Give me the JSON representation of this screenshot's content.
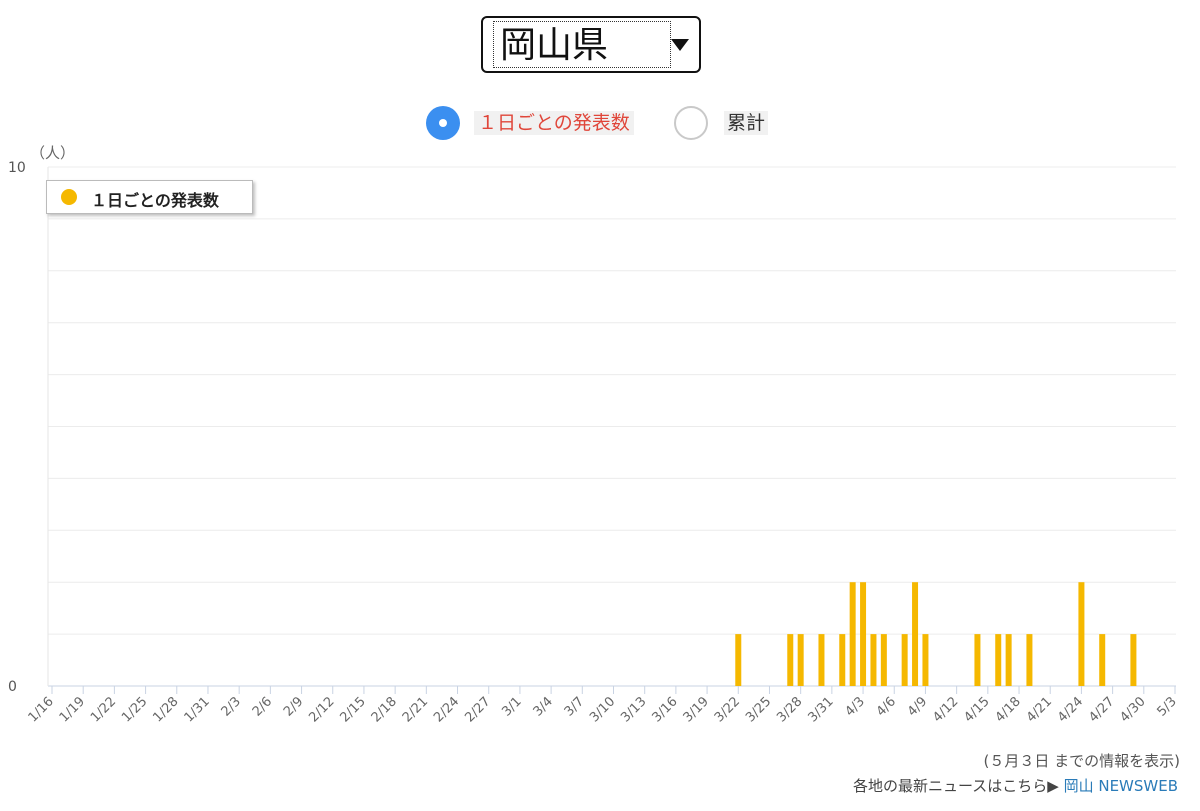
{
  "selector": {
    "label": "岡山県"
  },
  "mode": {
    "daily_label": "１日ごとの発表数",
    "cumulative_label": "累計"
  },
  "legend": {
    "label": "１日ごとの発表数"
  },
  "footer": {
    "note": "(５月３日 までの情報を表示)",
    "news_prefix": "各地の最新ニュースはこちら▶",
    "news_link": "岡山 NEWSWEB"
  },
  "colors": {
    "bar": "#f5b800",
    "accent": "#3b8ff0",
    "daily_text": "#e0463a",
    "link": "#2a7bb8"
  },
  "chart_data": {
    "type": "bar",
    "unit_label": "（人）",
    "ylim": [
      0,
      10
    ],
    "ytick_labels": [
      "10",
      "0"
    ],
    "grid": true,
    "legend_position": "top-left",
    "x_tick_labels": [
      "1/16",
      "1/19",
      "1/22",
      "1/25",
      "1/28",
      "1/31",
      "2/3",
      "2/6",
      "2/9",
      "2/12",
      "2/15",
      "2/18",
      "2/21",
      "2/24",
      "2/27",
      "3/1",
      "3/4",
      "3/7",
      "3/10",
      "3/13",
      "3/16",
      "3/19",
      "3/22",
      "3/25",
      "3/28",
      "3/31",
      "4/3",
      "4/6",
      "4/9",
      "4/12",
      "4/15",
      "4/18",
      "4/21",
      "4/24",
      "4/27",
      "4/30",
      "5/3"
    ],
    "series": [
      {
        "name": "１日ごとの発表数",
        "points": [
          {
            "date": "3/22",
            "value": 1
          },
          {
            "date": "3/27",
            "value": 1
          },
          {
            "date": "3/28",
            "value": 1
          },
          {
            "date": "3/30",
            "value": 1
          },
          {
            "date": "4/1",
            "value": 1
          },
          {
            "date": "4/2",
            "value": 2
          },
          {
            "date": "4/3",
            "value": 2
          },
          {
            "date": "4/4",
            "value": 1
          },
          {
            "date": "4/5",
            "value": 1
          },
          {
            "date": "4/7",
            "value": 1
          },
          {
            "date": "4/8",
            "value": 2
          },
          {
            "date": "4/9",
            "value": 1
          },
          {
            "date": "4/14",
            "value": 1
          },
          {
            "date": "4/16",
            "value": 1
          },
          {
            "date": "4/17",
            "value": 1
          },
          {
            "date": "4/19",
            "value": 1
          },
          {
            "date": "4/24",
            "value": 2
          },
          {
            "date": "4/26",
            "value": 1
          },
          {
            "date": "4/29",
            "value": 1
          }
        ]
      }
    ]
  }
}
